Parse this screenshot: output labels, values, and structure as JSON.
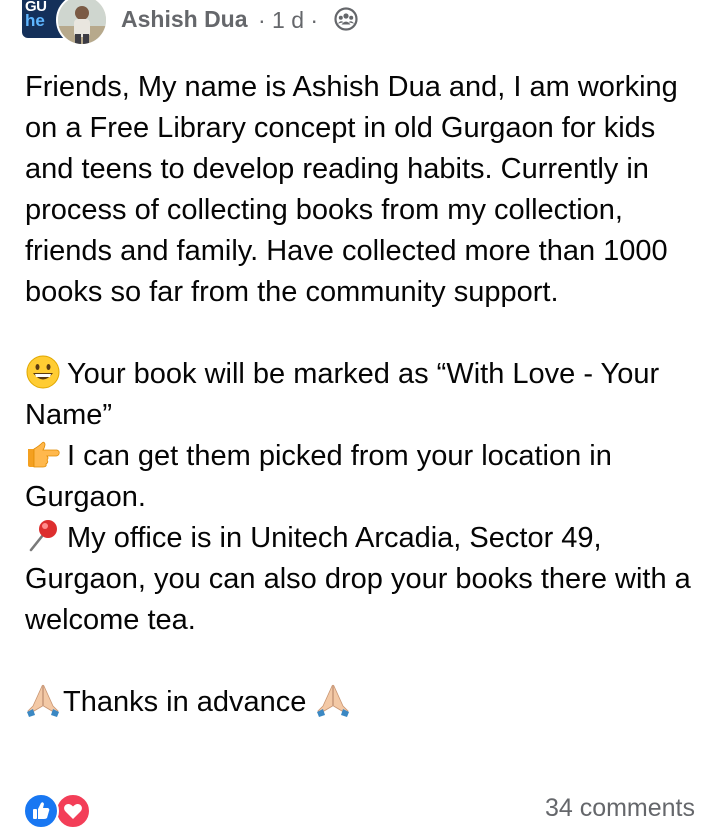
{
  "post": {
    "group_avatar_text_1": "GU",
    "group_avatar_text_2": "he",
    "author": "Ashish Dua",
    "meta": "· 1 d ·",
    "lines": {
      "p1": "Friends, My name is Ashish Dua and, I am working on a Free Library concept in old Gurgaon for kids and teens to develop reading habits. Currently in process of collecting books from my collection, friends and family. Have collected more than 1000 books so far from the community support.",
      "p2": "Your book will be marked as “With Love - Your Name”",
      "p3": "I can get them picked from your location in Gurgaon.",
      "p4": "My office is in Unitech Arcadia, Sector 49, Gurgaon, you can also drop your books there with a welcome tea.",
      "p5": "Thanks in advance"
    },
    "icons": {
      "grinning": "grinning-face-emoji",
      "pointing": "backhand-pointing-right-emoji",
      "pin": "round-pushpin-emoji",
      "folded_hands": "folded-hands-emoji",
      "group": "group-privacy-icon",
      "like": "like-reaction-icon",
      "love": "love-reaction-icon"
    }
  },
  "footer": {
    "comments": "34 comments"
  },
  "colors": {
    "accent_blue": "#1877f2",
    "love_red": "#f33e58",
    "secondary_text": "#65676b"
  }
}
